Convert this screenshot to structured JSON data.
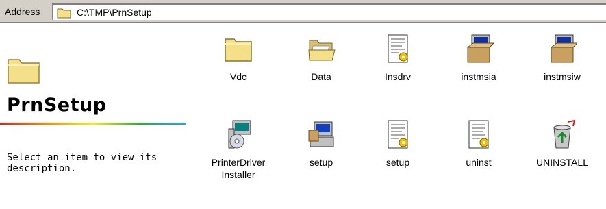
{
  "address": {
    "label": "Address",
    "path": "C:\\TMP\\PrnSetup",
    "icon": "folder-icon"
  },
  "panel": {
    "title": "PrnSetup",
    "description": "Select an item to view its description.",
    "icon": "folder-icon"
  },
  "items": [
    {
      "label": "Vdc",
      "icon": "folder-icon"
    },
    {
      "label": "Data",
      "icon": "open-folder-icon"
    },
    {
      "label": "Insdrv",
      "icon": "ini-file-icon"
    },
    {
      "label": "instmsia",
      "icon": "installer-box-icon"
    },
    {
      "label": "instmsiw",
      "icon": "installer-box-icon"
    },
    {
      "label": "PrinterDriver Installer",
      "icon": "printer-installer-icon"
    },
    {
      "label": "setup",
      "icon": "setup-computer-icon"
    },
    {
      "label": "setup",
      "icon": "ini-file-icon"
    },
    {
      "label": "uninst",
      "icon": "ini-file-icon"
    },
    {
      "label": "UNINSTALL",
      "icon": "recycle-bin-icon"
    }
  ],
  "colors": {
    "window_bg": "#d4d0c8",
    "folder_yellow": "#f5e08a",
    "accent_rule": [
      "#dd2222",
      "#ff8800",
      "#eeee22",
      "#33aa33",
      "#3399ff"
    ]
  }
}
